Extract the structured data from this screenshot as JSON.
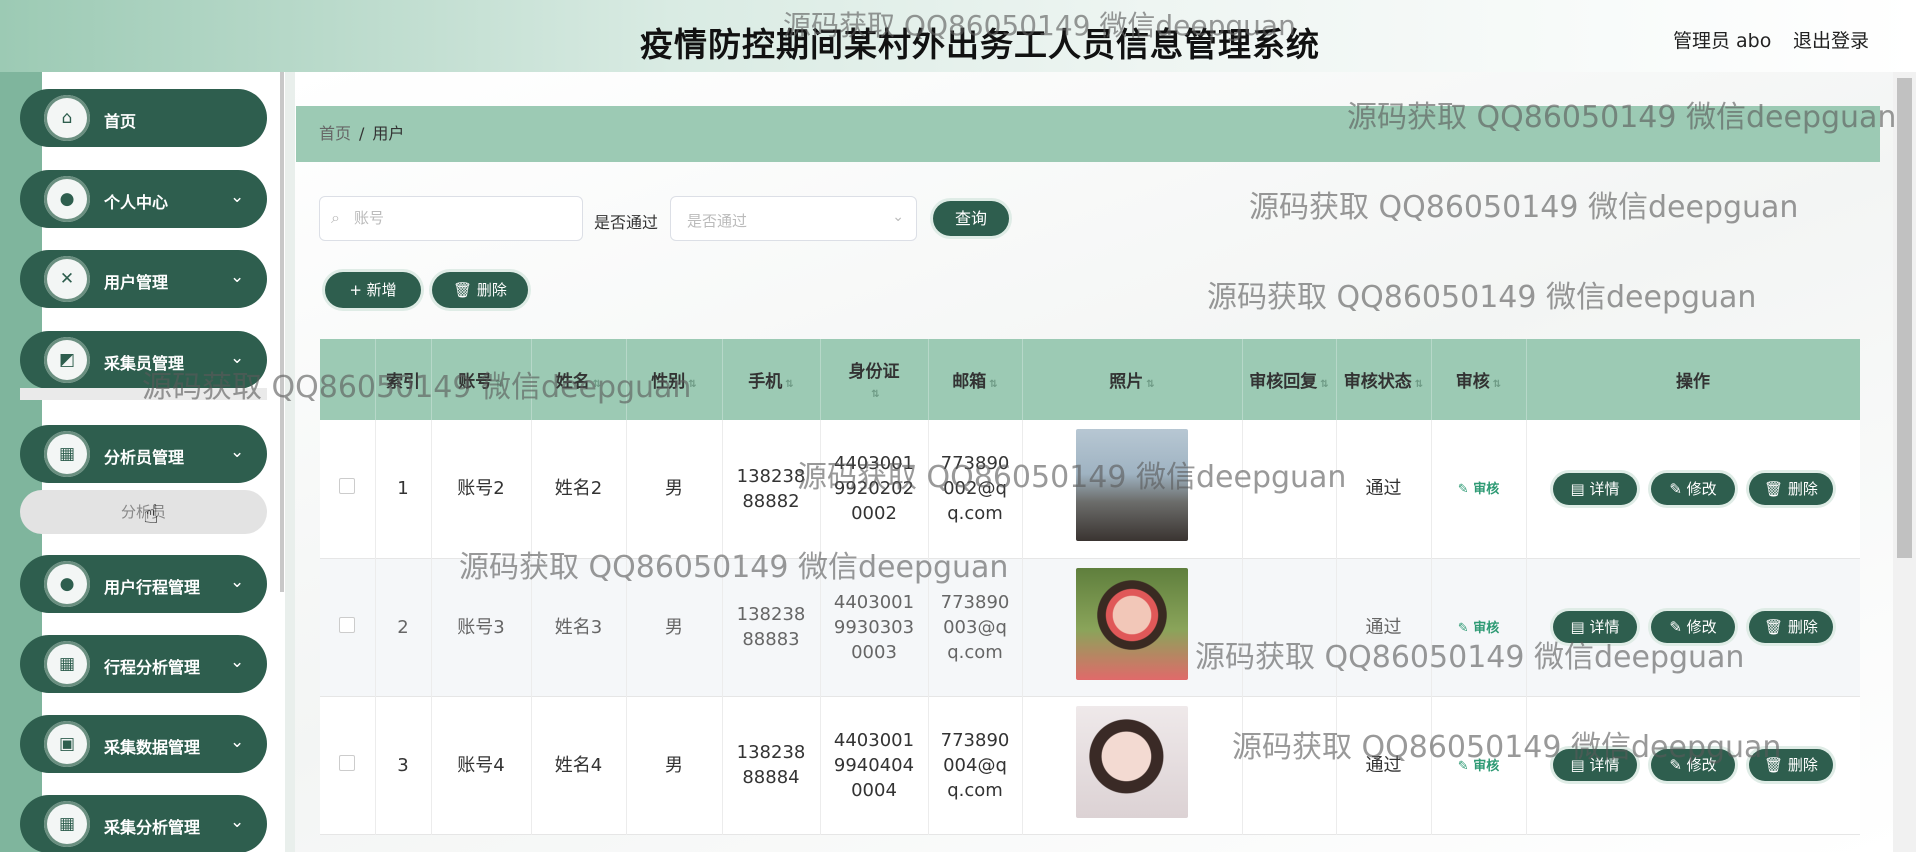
{
  "header": {
    "title": "疫情防控期间某村外出务工人员信息管理系统",
    "admin_label": "管理员 abo",
    "logout_label": "退出登录"
  },
  "sidebar": {
    "items": [
      {
        "label": "首页",
        "icon": "home-icon"
      },
      {
        "label": "个人中心",
        "icon": "user-icon"
      },
      {
        "label": "用户管理",
        "icon": "users-icon"
      },
      {
        "label": "采集员管理",
        "icon": "chart-icon"
      },
      {
        "label": "分析员管理",
        "icon": "grid-icon"
      },
      {
        "label": "用户行程管理",
        "icon": "user-icon"
      },
      {
        "label": "行程分析管理",
        "icon": "grid-icon"
      },
      {
        "label": "采集数据管理",
        "icon": "clipboard-icon"
      },
      {
        "label": "采集分析管理",
        "icon": "grid-icon"
      }
    ],
    "submenu_label": "分析员"
  },
  "breadcrumb": {
    "home": "首页",
    "separator": "/",
    "current": "用户"
  },
  "search": {
    "account_placeholder": "账号",
    "pass_label": "是否通过",
    "pass_placeholder": "是否通过",
    "query_label": "查询"
  },
  "actions": {
    "add_label": "+ 新增",
    "delete_label": "删除"
  },
  "table": {
    "headers": [
      "索引",
      "账号",
      "姓名",
      "性别",
      "手机",
      "身份证",
      "邮箱",
      "照片",
      "审核回复",
      "审核状态",
      "审核",
      "操作"
    ],
    "rows": [
      {
        "index": "1",
        "account": "账号2",
        "name": "姓名2",
        "gender": "男",
        "phone": "13823888882",
        "idcard": "440300199202020002",
        "email": "773890002@qq.com",
        "reply": "",
        "status": "通过",
        "audit": "审核"
      },
      {
        "index": "2",
        "account": "账号3",
        "name": "姓名3",
        "gender": "男",
        "phone": "13823888883",
        "idcard": "440300199303030003",
        "email": "773890003@qq.com",
        "reply": "",
        "status": "通过",
        "audit": "审核"
      },
      {
        "index": "3",
        "account": "账号4",
        "name": "姓名4",
        "gender": "男",
        "phone": "13823888884",
        "idcard": "440300199404040004",
        "email": "773890004@qq.com",
        "reply": "",
        "status": "通过",
        "audit": "审核"
      }
    ],
    "op_labels": {
      "detail": "详情",
      "edit": "修改",
      "delete": "删除"
    }
  },
  "watermark": "源码获取 QQ86050149 微信deepguan",
  "colors": {
    "primary": "#2e5e4e",
    "accent": "#9ccab4",
    "link": "#2e9a74"
  }
}
